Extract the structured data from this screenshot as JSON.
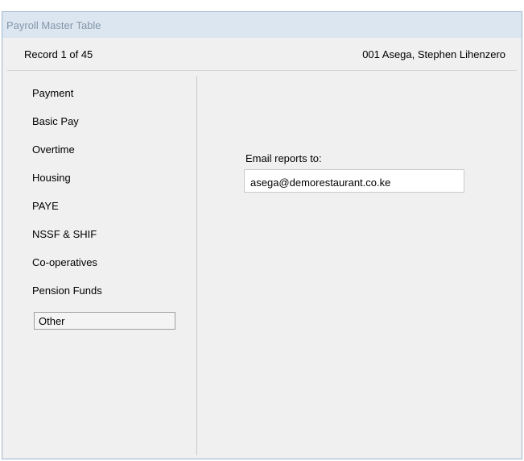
{
  "window": {
    "title": "Payroll Master Table"
  },
  "record_bar": {
    "record_count": "Record 1 of 45",
    "employee": "001  Asega, Stephen Lihenzero"
  },
  "sidebar": {
    "items": [
      {
        "label": "Payment"
      },
      {
        "label": "Basic Pay"
      },
      {
        "label": "Overtime"
      },
      {
        "label": "Housing"
      },
      {
        "label": "PAYE"
      },
      {
        "label": "NSSF & SHIF"
      },
      {
        "label": "Co-operatives"
      },
      {
        "label": "Pension Funds"
      },
      {
        "label": "Other"
      }
    ],
    "selected": "Other"
  },
  "main": {
    "email_label": "Email reports to:",
    "email_value": "asega@demorestaurant.co.ke"
  },
  "colors": {
    "titlebar_bg": "#dbe6f1",
    "title_text": "#8596a8",
    "window_bg": "#f0f0f0"
  }
}
